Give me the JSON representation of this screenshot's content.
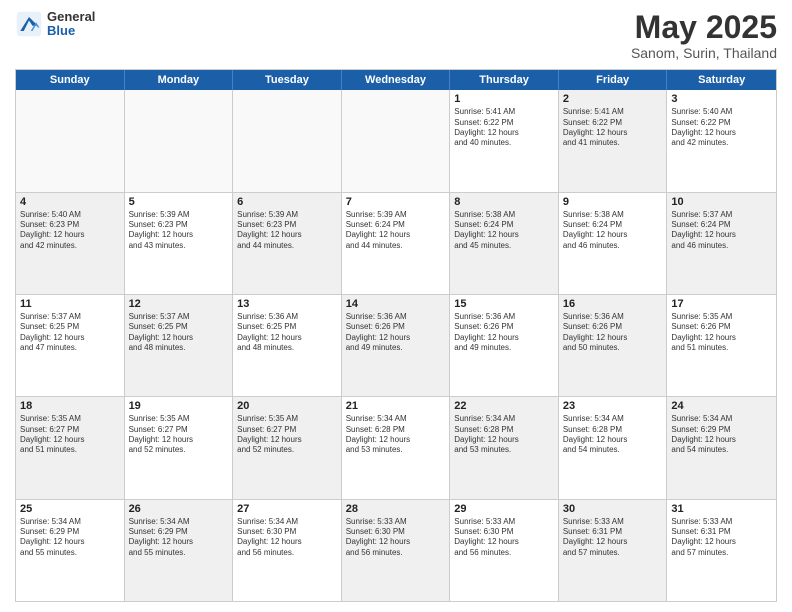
{
  "header": {
    "logo_general": "General",
    "logo_blue": "Blue",
    "title": "May 2025",
    "subtitle": "Sanom, Surin, Thailand"
  },
  "calendar": {
    "days_of_week": [
      "Sunday",
      "Monday",
      "Tuesday",
      "Wednesday",
      "Thursday",
      "Friday",
      "Saturday"
    ],
    "weeks": [
      [
        {
          "day": "",
          "info": "",
          "empty": true
        },
        {
          "day": "",
          "info": "",
          "empty": true
        },
        {
          "day": "",
          "info": "",
          "empty": true
        },
        {
          "day": "",
          "info": "",
          "empty": true
        },
        {
          "day": "1",
          "info": "Sunrise: 5:41 AM\nSunset: 6:22 PM\nDaylight: 12 hours\nand 40 minutes.",
          "shade": false
        },
        {
          "day": "2",
          "info": "Sunrise: 5:41 AM\nSunset: 6:22 PM\nDaylight: 12 hours\nand 41 minutes.",
          "shade": true
        },
        {
          "day": "3",
          "info": "Sunrise: 5:40 AM\nSunset: 6:22 PM\nDaylight: 12 hours\nand 42 minutes.",
          "shade": false
        }
      ],
      [
        {
          "day": "4",
          "info": "Sunrise: 5:40 AM\nSunset: 6:23 PM\nDaylight: 12 hours\nand 42 minutes.",
          "shade": true
        },
        {
          "day": "5",
          "info": "Sunrise: 5:39 AM\nSunset: 6:23 PM\nDaylight: 12 hours\nand 43 minutes.",
          "shade": false
        },
        {
          "day": "6",
          "info": "Sunrise: 5:39 AM\nSunset: 6:23 PM\nDaylight: 12 hours\nand 44 minutes.",
          "shade": true
        },
        {
          "day": "7",
          "info": "Sunrise: 5:39 AM\nSunset: 6:24 PM\nDaylight: 12 hours\nand 44 minutes.",
          "shade": false
        },
        {
          "day": "8",
          "info": "Sunrise: 5:38 AM\nSunset: 6:24 PM\nDaylight: 12 hours\nand 45 minutes.",
          "shade": true
        },
        {
          "day": "9",
          "info": "Sunrise: 5:38 AM\nSunset: 6:24 PM\nDaylight: 12 hours\nand 46 minutes.",
          "shade": false
        },
        {
          "day": "10",
          "info": "Sunrise: 5:37 AM\nSunset: 6:24 PM\nDaylight: 12 hours\nand 46 minutes.",
          "shade": true
        }
      ],
      [
        {
          "day": "11",
          "info": "Sunrise: 5:37 AM\nSunset: 6:25 PM\nDaylight: 12 hours\nand 47 minutes.",
          "shade": false
        },
        {
          "day": "12",
          "info": "Sunrise: 5:37 AM\nSunset: 6:25 PM\nDaylight: 12 hours\nand 48 minutes.",
          "shade": true
        },
        {
          "day": "13",
          "info": "Sunrise: 5:36 AM\nSunset: 6:25 PM\nDaylight: 12 hours\nand 48 minutes.",
          "shade": false
        },
        {
          "day": "14",
          "info": "Sunrise: 5:36 AM\nSunset: 6:26 PM\nDaylight: 12 hours\nand 49 minutes.",
          "shade": true
        },
        {
          "day": "15",
          "info": "Sunrise: 5:36 AM\nSunset: 6:26 PM\nDaylight: 12 hours\nand 49 minutes.",
          "shade": false
        },
        {
          "day": "16",
          "info": "Sunrise: 5:36 AM\nSunset: 6:26 PM\nDaylight: 12 hours\nand 50 minutes.",
          "shade": true
        },
        {
          "day": "17",
          "info": "Sunrise: 5:35 AM\nSunset: 6:26 PM\nDaylight: 12 hours\nand 51 minutes.",
          "shade": false
        }
      ],
      [
        {
          "day": "18",
          "info": "Sunrise: 5:35 AM\nSunset: 6:27 PM\nDaylight: 12 hours\nand 51 minutes.",
          "shade": true
        },
        {
          "day": "19",
          "info": "Sunrise: 5:35 AM\nSunset: 6:27 PM\nDaylight: 12 hours\nand 52 minutes.",
          "shade": false
        },
        {
          "day": "20",
          "info": "Sunrise: 5:35 AM\nSunset: 6:27 PM\nDaylight: 12 hours\nand 52 minutes.",
          "shade": true
        },
        {
          "day": "21",
          "info": "Sunrise: 5:34 AM\nSunset: 6:28 PM\nDaylight: 12 hours\nand 53 minutes.",
          "shade": false
        },
        {
          "day": "22",
          "info": "Sunrise: 5:34 AM\nSunset: 6:28 PM\nDaylight: 12 hours\nand 53 minutes.",
          "shade": true
        },
        {
          "day": "23",
          "info": "Sunrise: 5:34 AM\nSunset: 6:28 PM\nDaylight: 12 hours\nand 54 minutes.",
          "shade": false
        },
        {
          "day": "24",
          "info": "Sunrise: 5:34 AM\nSunset: 6:29 PM\nDaylight: 12 hours\nand 54 minutes.",
          "shade": true
        }
      ],
      [
        {
          "day": "25",
          "info": "Sunrise: 5:34 AM\nSunset: 6:29 PM\nDaylight: 12 hours\nand 55 minutes.",
          "shade": false
        },
        {
          "day": "26",
          "info": "Sunrise: 5:34 AM\nSunset: 6:29 PM\nDaylight: 12 hours\nand 55 minutes.",
          "shade": true
        },
        {
          "day": "27",
          "info": "Sunrise: 5:34 AM\nSunset: 6:30 PM\nDaylight: 12 hours\nand 56 minutes.",
          "shade": false
        },
        {
          "day": "28",
          "info": "Sunrise: 5:33 AM\nSunset: 6:30 PM\nDaylight: 12 hours\nand 56 minutes.",
          "shade": true
        },
        {
          "day": "29",
          "info": "Sunrise: 5:33 AM\nSunset: 6:30 PM\nDaylight: 12 hours\nand 56 minutes.",
          "shade": false
        },
        {
          "day": "30",
          "info": "Sunrise: 5:33 AM\nSunset: 6:31 PM\nDaylight: 12 hours\nand 57 minutes.",
          "shade": true
        },
        {
          "day": "31",
          "info": "Sunrise: 5:33 AM\nSunset: 6:31 PM\nDaylight: 12 hours\nand 57 minutes.",
          "shade": false
        }
      ]
    ]
  }
}
